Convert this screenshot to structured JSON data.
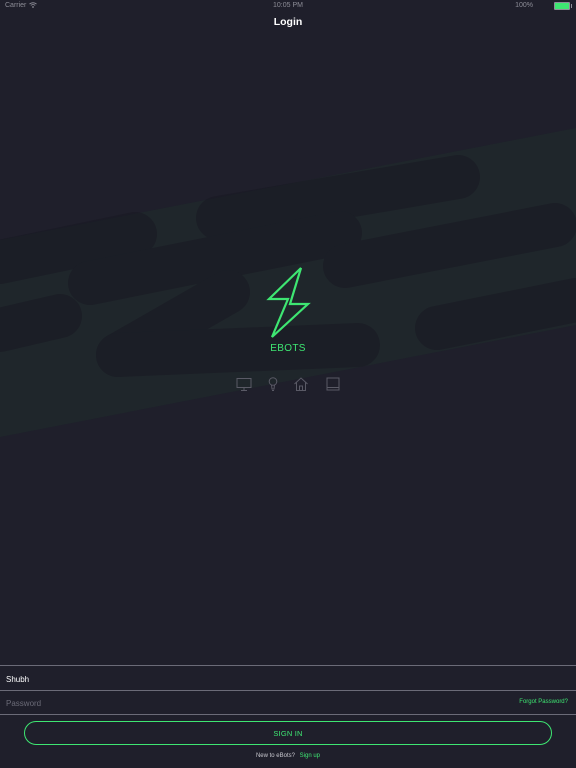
{
  "status_bar": {
    "carrier": "Carrier",
    "time": "10:05 PM",
    "battery_percent": "100%"
  },
  "nav": {
    "title": "Login"
  },
  "brand": {
    "name": "EBOTS",
    "logo_icon": "lightning-bolt-icon",
    "feature_icons": [
      "monitor-icon",
      "bulb-icon",
      "home-icon",
      "tablet-icon"
    ]
  },
  "form": {
    "username_value": "Shubh",
    "password_placeholder": "Password",
    "forgot_password": "Forgot Password?",
    "sign_in": "SIGN IN",
    "signup_prompt": "New to eBots?",
    "signup_link": "Sign up"
  },
  "colors": {
    "background": "#1f1f2b",
    "accent": "#3ee672",
    "divider": "#6b6b78"
  }
}
